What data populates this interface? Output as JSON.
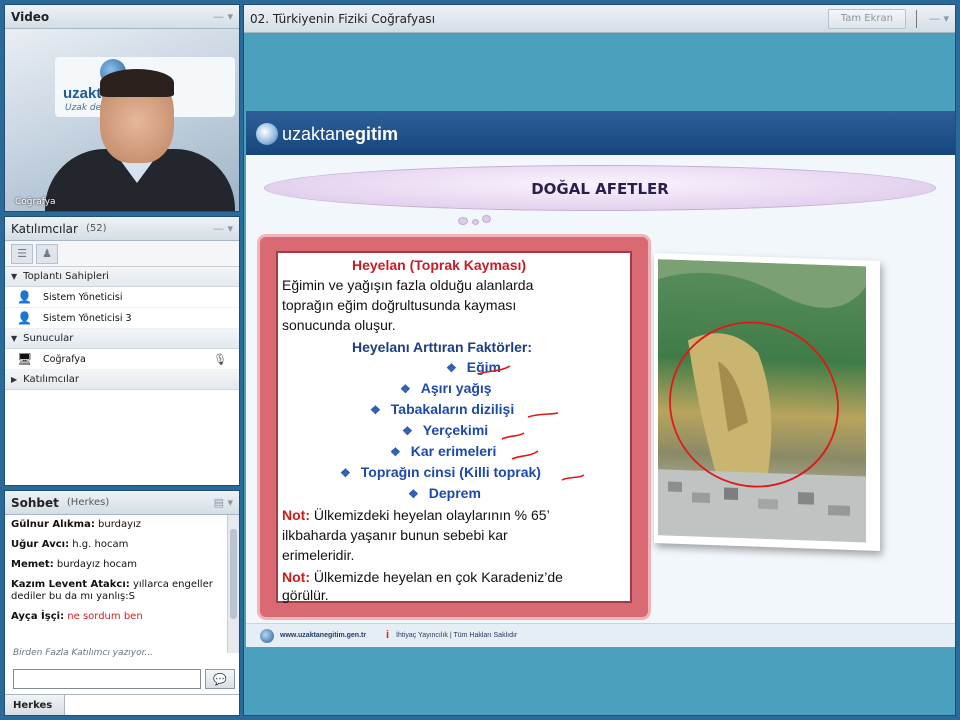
{
  "video": {
    "title": "Video",
    "banner_text": "uzaktanegitimtr",
    "banner_sub": "Uzak demek...",
    "caption": "Coğrafya"
  },
  "attendees": {
    "title": "Katılımcılar",
    "count": "(52)",
    "groups": [
      {
        "label": "Toplantı Sahipleri",
        "expanded": true
      },
      {
        "label": "Sunucular",
        "expanded": true
      },
      {
        "label": "Katılımcılar",
        "expanded": false
      }
    ],
    "hosts": [
      "Sistem Yöneticisi",
      "Sistem Yöneticisi 3"
    ],
    "presenters": [
      "Coğrafya"
    ]
  },
  "chat": {
    "title": "Sohbet",
    "scope": "(Herkes)",
    "messages": [
      {
        "author": "Gülnur Alıkma:",
        "text": "burdayız",
        "highlight": false
      },
      {
        "author": "Uğur Avcı:",
        "text": "h.g. hocam",
        "highlight": false
      },
      {
        "author": "Memet:",
        "text": "burdayız hocam",
        "highlight": false
      },
      {
        "author": "Kazım Levent Atakcı:",
        "text": "yıllarca engeller dediler bu da mı yanlış:S",
        "highlight": false
      },
      {
        "author": "Ayça İşçi:",
        "text": "ne sordum ben",
        "highlight": true
      }
    ],
    "typing": "Birden Fazla Katılımcı yazıyor...",
    "tab": "Herkes"
  },
  "share": {
    "title": "02. Türkiyenin Fiziki Coğrafyası",
    "fullscreen_label": "Tam Ekran"
  },
  "slide": {
    "logo_prefix": "uzaktan",
    "logo_suffix": "egitim",
    "title": "DOĞAL AFETLER",
    "heading": "Heyelan  (Toprak Kayması)",
    "body_lines": [
      "Eğimin ve yağışın fazla olduğu alanlarda",
      "toprağın eğim doğrultusunda  kayması",
      "sonucunda oluşur."
    ],
    "factors_title": "Heyelanı Arttıran Faktörler:",
    "factors": [
      "Eğim",
      "Aşırı yağış",
      "Tabakaların dizilişi",
      "Yerçekimi",
      "Kar erimeleri",
      "Toprağın cinsi (Killi toprak)",
      "Deprem"
    ],
    "note_label": "Not:",
    "note1_lines": [
      " Ülkemizdeki heyelan olaylarının % 65’",
      "ilkbaharda yaşanır bunun sebebi kar",
      "erimeleridir."
    ],
    "note2_lines": [
      " Ülkemizde heyelan en çok Karadeniz’de",
      "görülür."
    ],
    "footer_site": "www.uzaktanegitim.gen.tr",
    "footer_copy": "İhtiyaç Yayıncılık | Tüm Hakları Saklıdır"
  },
  "colors": {
    "accent": "#2a6a98",
    "slide_heading": "#c41e2a",
    "factor_blue": "#1d4aa8",
    "annotation_red": "#e01818"
  }
}
